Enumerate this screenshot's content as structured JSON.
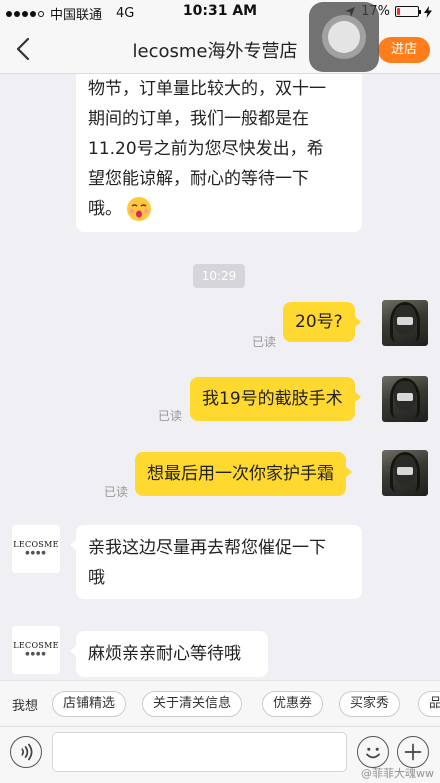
{
  "status_bar": {
    "carrier": "中国联通",
    "network": "4G",
    "time": "10:31 AM",
    "battery_percent": "17%",
    "battery_level": 0.17
  },
  "nav": {
    "title": "lecosme海外专营店",
    "enter_store_label": "进店"
  },
  "messages": {
    "shop_partial": {
      "lines": [
        "物节，订单量比较大的，双十一",
        "期间的订单，我们一般都是在",
        "11.20号之前为您尽快发出，希",
        "望您能谅解，耐心的等待一下",
        "哦。"
      ],
      "emoji": "kiss-emoji"
    },
    "time_divider": "10:29",
    "user": [
      {
        "text": "20号?",
        "read": "已读"
      },
      {
        "text": "我19号的截肢手术",
        "read": "已读"
      },
      {
        "text": "想最后用一次你家护手霜",
        "read": "已读"
      }
    ],
    "shop": [
      {
        "lines": [
          "亲我这边尽量再去帮您催促一下",
          "哦"
        ]
      },
      {
        "lines": [
          "麻烦亲亲耐心等待哦"
        ]
      }
    ],
    "shop_logo": "LECOSME"
  },
  "quick_bar": {
    "lead": "我想",
    "tags": [
      "店铺精选",
      "关于清关信息",
      "优惠券",
      "买家秀",
      "品"
    ]
  },
  "input": {
    "placeholder": ""
  },
  "watermark": "@菲菲大魂ww"
}
